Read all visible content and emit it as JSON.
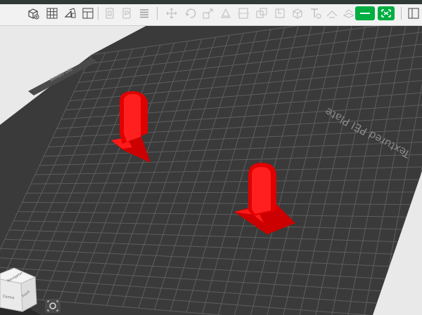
{
  "viewport": {
    "plate_label": "Textured PEI Plate",
    "plate_side_text": "BAMBU LAB",
    "navcube_faces": [
      "Navigator",
      "Front",
      "Centre"
    ]
  },
  "toolbar": {
    "icons": [
      "add-cube-icon",
      "grid-arrange-icon",
      "orient-icon",
      "layout-icon",
      "plate-left-icon",
      "plate-right-icon",
      "list-icon",
      "move-icon",
      "rotate-icon",
      "scale-icon",
      "lay-on-face-icon",
      "cut-icon",
      "mesh-boolean-icon",
      "support-paint-icon",
      "seam-paint-icon",
      "text-icon",
      "measure-icon",
      "assembly-icon"
    ],
    "accent_color": "#00ae42"
  },
  "colors": {
    "bed": "#3a3a3a",
    "grid": "#5e5e5e",
    "model": "#e60000",
    "background": "#e9e9e9"
  }
}
